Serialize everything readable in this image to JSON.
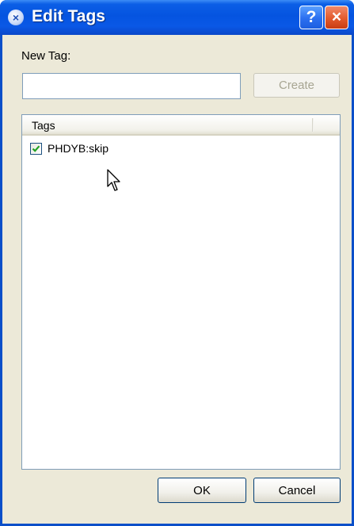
{
  "window": {
    "title": "Edit Tags",
    "help_label": "?",
    "close_label": "×",
    "title_icon": "×"
  },
  "new_tag": {
    "label": "New Tag:",
    "value": "",
    "create_label": "Create"
  },
  "tags": {
    "header": "Tags",
    "items": [
      {
        "label": "PHDYB:skip",
        "checked": true
      }
    ]
  },
  "buttons": {
    "ok_label": "OK",
    "cancel_label": "Cancel"
  },
  "colors": {
    "titlebar": "#0554e0",
    "window_bg": "#ece9d8",
    "check_mark": "#21a121",
    "close_button": "#e25a2c"
  },
  "icons": {
    "title": "close-icon",
    "help": "help-icon",
    "close": "close-icon",
    "checkbox": "check-icon",
    "cursor": "mouse-cursor-icon"
  }
}
